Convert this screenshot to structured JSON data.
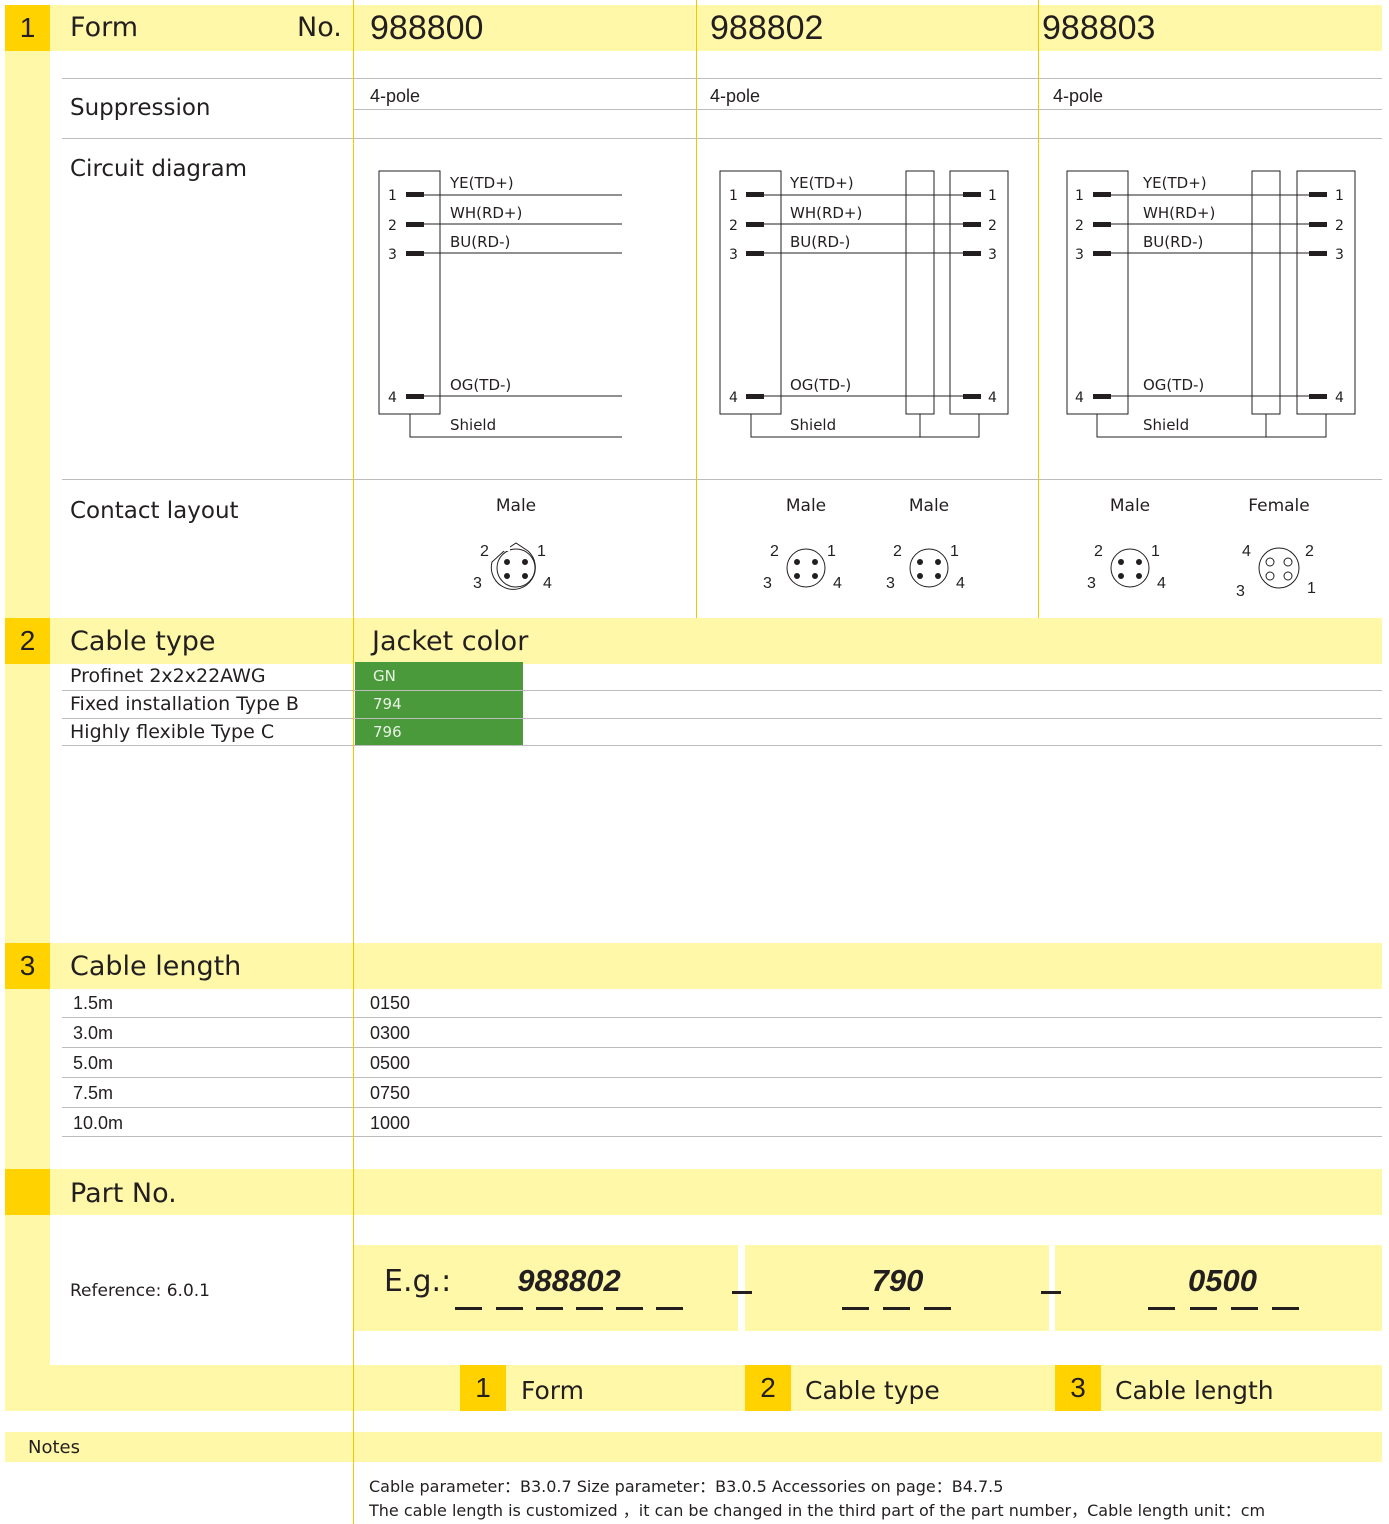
{
  "section1": {
    "number": "1",
    "title": "Form",
    "no_label": "No.",
    "columns": [
      {
        "part": "988800",
        "suppression": "4-pole",
        "contacts": [
          "Male"
        ]
      },
      {
        "part": "988802",
        "suppression": "4-pole",
        "contacts": [
          "Male",
          "Male"
        ]
      },
      {
        "part": "988803",
        "suppression": "4-pole",
        "contacts": [
          "Male",
          "Female"
        ]
      }
    ],
    "rows": {
      "suppression": "Suppression",
      "circuit": "Circuit diagram",
      "contact": "Contact layout"
    },
    "wires": [
      "YE(TD+)",
      "WH(RD+)",
      "BU(RD-)",
      "OG(TD-)",
      "Shield"
    ],
    "pins": [
      "1",
      "2",
      "3",
      "4"
    ]
  },
  "section2": {
    "number": "2",
    "title": "Cable type",
    "jacket_header": "Jacket color",
    "rows": [
      {
        "label": "Profinet  2x2x22AWG",
        "value": "GN"
      },
      {
        "label": "Fixed installation Type B",
        "value": "794"
      },
      {
        "label": "Highly flexible Type C",
        "value": "796"
      }
    ],
    "jacket_color": "#4a9a3c"
  },
  "section3": {
    "number": "3",
    "title": "Cable length",
    "rows": [
      {
        "label": "1.5m",
        "value": "0150"
      },
      {
        "label": "3.0m",
        "value": "0300"
      },
      {
        "label": "5.0m",
        "value": "0500"
      },
      {
        "label": "7.5m",
        "value": "0750"
      },
      {
        "label": "10.0m",
        "value": "1000"
      }
    ]
  },
  "partno": {
    "title": "Part No.",
    "reference": "Reference: 6.0.1",
    "eg_label": "E.g.:",
    "parts": [
      "988802",
      "790",
      "0500"
    ],
    "legend": [
      {
        "num": "1",
        "label": "Form"
      },
      {
        "num": "2",
        "label": "Cable type"
      },
      {
        "num": "3",
        "label": "Cable length"
      }
    ]
  },
  "notes": {
    "title": "Notes",
    "line1": "Cable parameter：B3.0.7    Size parameter：B3.0.5     Accessories on page：B4.7.5",
    "line2": "The cable length is customized ，it can be changed in the third part of the part number，Cable length unit：cm"
  },
  "colors": {
    "accent": "#ffd200",
    "band": "#fff8a8",
    "green": "#4a9a3c"
  }
}
